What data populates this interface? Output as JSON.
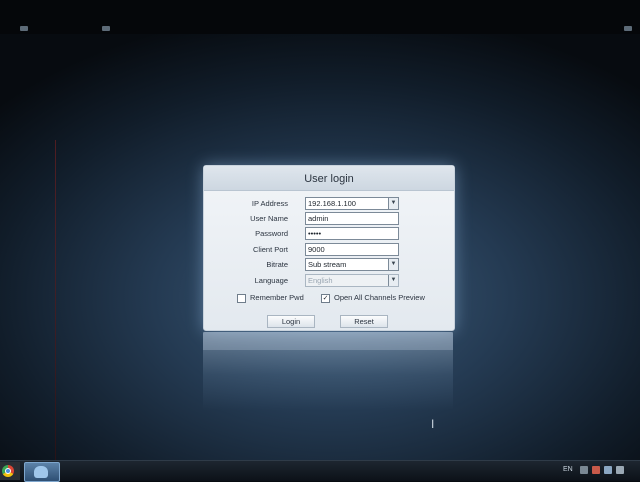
{
  "dialog": {
    "title": "User login",
    "fields": {
      "ip_address": {
        "label": "IP Address",
        "value": "192.168.1.100"
      },
      "user_name": {
        "label": "User Name",
        "value": "admin"
      },
      "password": {
        "label": "Password",
        "value": "•••••"
      },
      "client_port": {
        "label": "Client Port",
        "value": "9000"
      },
      "bitrate": {
        "label": "Bitrate",
        "value": "Sub stream"
      },
      "language": {
        "label": "Language",
        "value": "English"
      }
    },
    "remember_pwd": {
      "label": "Remember Pwd",
      "checked": false
    },
    "open_all_channels": {
      "label": "Open All Channels Preview",
      "checked": true,
      "mark": "✓"
    },
    "buttons": {
      "login": "Login",
      "reset": "Reset"
    }
  },
  "taskbar": {
    "tray": {
      "language": "EN"
    }
  },
  "icons": {
    "dropdown": "chevron-down-icon",
    "cursor": "text-cursor-icon",
    "browser": "chrome-icon",
    "app": "client-app-icon",
    "tray": [
      "network-icon",
      "flag-icon",
      "display-icon",
      "volume-icon"
    ]
  },
  "colors": {
    "desktop": "#243a52",
    "dialog_bg": "#e3e9ef",
    "taskbar": "#0c1118"
  }
}
